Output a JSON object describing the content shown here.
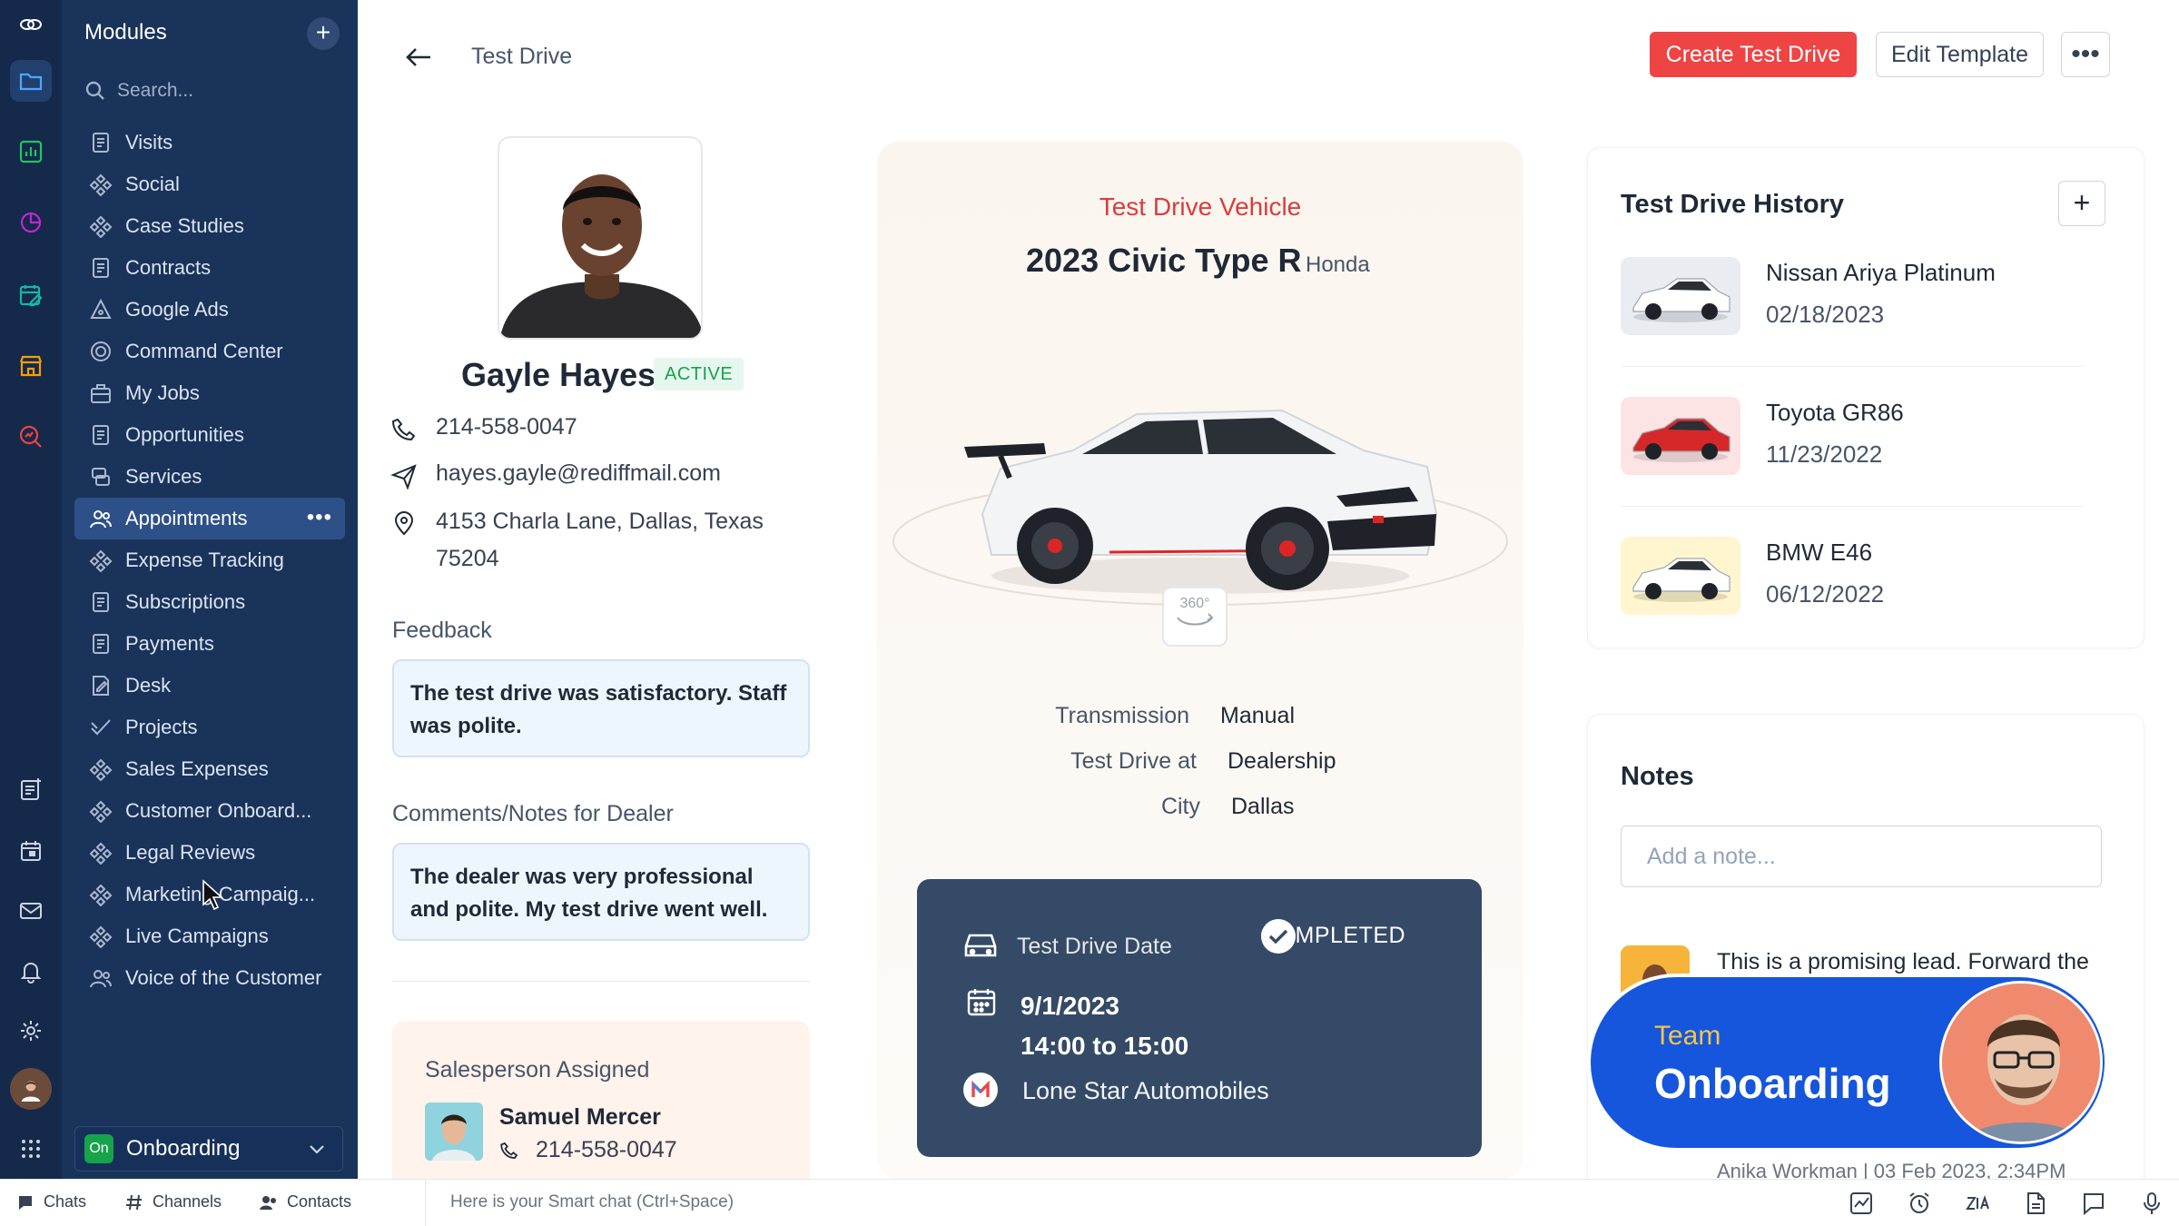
{
  "colors": {
    "accent": "#ef4444",
    "sidebar": "#1a335a",
    "rail": "#15294b",
    "active_item": "#2d5088",
    "status_green": "#16a34a",
    "overlay_blue": "#1556dd"
  },
  "rail": {
    "icons": [
      "logo-icon",
      "folder-icon",
      "chart-icon",
      "pie-chart-icon",
      "calendar-edit-icon",
      "store-icon",
      "search-chart-icon",
      "notes-add-icon",
      "calendar-icon",
      "mail-icon",
      "bell-icon",
      "settings-icon",
      "user-avatar",
      "apps-grid-icon"
    ]
  },
  "sidebar": {
    "header": "Modules",
    "add_label": "+",
    "search_placeholder": "Search...",
    "items": [
      {
        "label": "Visits",
        "icon": "page-icon"
      },
      {
        "label": "Social",
        "icon": "network-icon"
      },
      {
        "label": "Case Studies",
        "icon": "network-icon"
      },
      {
        "label": "Contracts",
        "icon": "page-icon"
      },
      {
        "label": "Google Ads",
        "icon": "triangle-icon"
      },
      {
        "label": "Command Center",
        "icon": "target-icon"
      },
      {
        "label": "My Jobs",
        "icon": "briefcase-icon"
      },
      {
        "label": "Opportunities",
        "icon": "page-icon"
      },
      {
        "label": "Services",
        "icon": "stack-icon"
      },
      {
        "label": "Appointments",
        "icon": "people-icon"
      },
      {
        "label": "Expense Tracking",
        "icon": "network-icon"
      },
      {
        "label": "Subscriptions",
        "icon": "page-icon"
      },
      {
        "label": "Payments",
        "icon": "page-icon"
      },
      {
        "label": "Desk",
        "icon": "edit-page-icon"
      },
      {
        "label": "Projects",
        "icon": "check-icon"
      },
      {
        "label": "Sales Expenses",
        "icon": "network-icon"
      },
      {
        "label": "Customer Onboard...",
        "icon": "network-icon"
      },
      {
        "label": "Legal Reviews",
        "icon": "network-icon"
      },
      {
        "label": "Marketing Campaig...",
        "icon": "network-icon"
      },
      {
        "label": "Live Campaigns",
        "icon": "network-icon"
      },
      {
        "label": "Voice of the Customer",
        "icon": "people-icon"
      }
    ],
    "active_index": 9,
    "active_more": "•••",
    "footer": {
      "badge": "On",
      "label": "Onboarding"
    }
  },
  "topbar": {
    "title": "Test Drive",
    "create_label": "Create Test Drive",
    "edit_label": "Edit Template",
    "more_label": "•••"
  },
  "customer": {
    "name": "Gayle Hayes",
    "status": "ACTIVE",
    "phone": "214-558-0047",
    "email": "hayes.gayle@rediffmail.com",
    "address_line1": "4153 Charla Lane, Dallas, Texas",
    "address_line2": "75204",
    "feedback_label": "Feedback",
    "feedback_text": "The test drive was satisfactory. Staff was polite.",
    "comments_label": "Comments/Notes for Dealer",
    "comments_text": "The dealer was very professional and polite. My test drive went well.",
    "salesperson": {
      "label": "Salesperson Assigned",
      "name": "Samuel Mercer",
      "phone": "214-558-0047"
    }
  },
  "vehicle": {
    "kicker": "Test Drive Vehicle",
    "model": "2023 Civic Type R",
    "brand": "Honda",
    "badge_360": "360°",
    "specs": [
      {
        "key": "Transmission",
        "value": "Manual"
      },
      {
        "key": "Test Drive at",
        "value": "Dealership"
      },
      {
        "key": "City",
        "value": "Dallas"
      }
    ],
    "drive": {
      "date_label": "Test Drive Date",
      "status": "COMPLETED",
      "date": "9/1/2023",
      "time": "14:00 to 15:00",
      "location": "Lone Star Automobiles"
    }
  },
  "history": {
    "title": "Test Drive History",
    "add_label": "+",
    "items": [
      {
        "name": "Nissan Ariya Platinum",
        "date": "02/18/2023",
        "color": "#ffffff"
      },
      {
        "name": "Toyota GR86",
        "date": "11/23/2022",
        "color": "#d62828"
      },
      {
        "name": "BMW E46",
        "date": "06/12/2022",
        "color": "#ffffff"
      }
    ]
  },
  "notes": {
    "title": "Notes",
    "placeholder": "Add a note...",
    "text": "This is a promising lead. Forward the",
    "meta": "Anika Workman  |  03 Feb 2023, 2:34PM"
  },
  "overlay": {
    "kicker": "Team",
    "title": "Onboarding"
  },
  "bottombar": {
    "chats": "Chats",
    "channels": "Channels",
    "contacts": "Contacts",
    "smart_chat": "Here is your Smart chat (Ctrl+Space)",
    "icons": [
      "activity-icon",
      "alarm-icon",
      "zia-icon",
      "document-icon",
      "chat-bubble-icon",
      "microphone-icon"
    ]
  }
}
